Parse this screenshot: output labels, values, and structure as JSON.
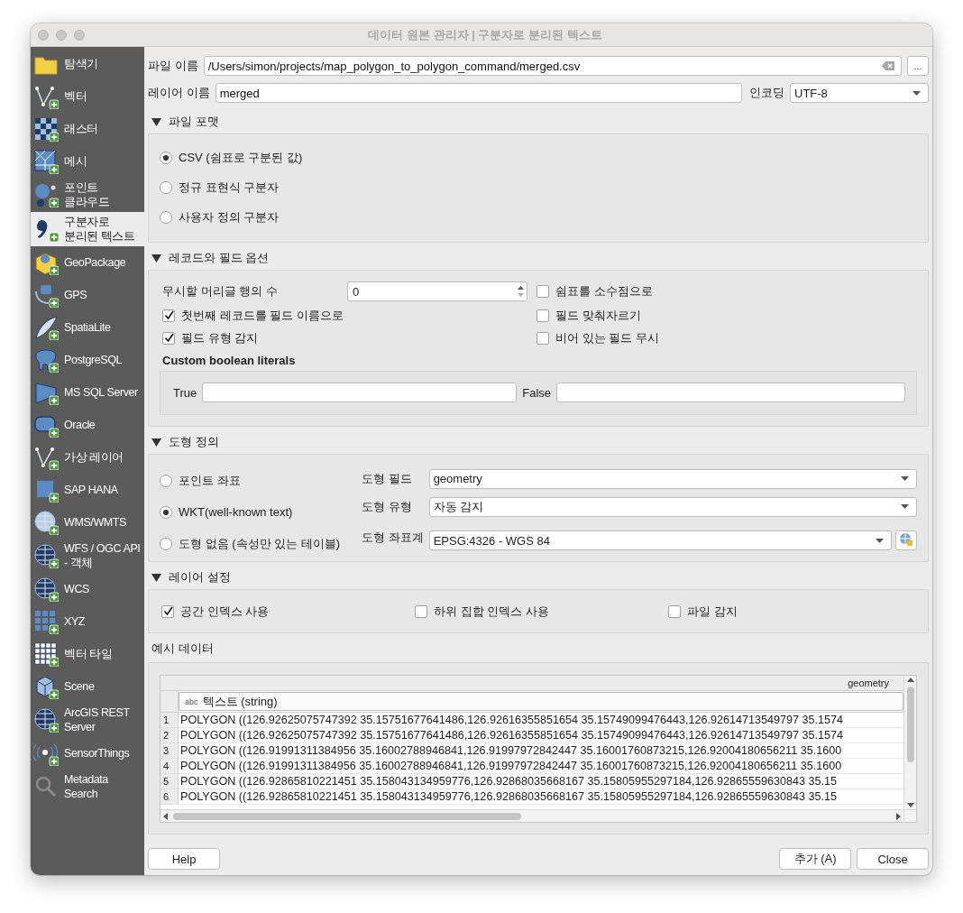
{
  "window": {
    "title": "데이터 원본 관리자 | 구분자로 분리된 텍스트"
  },
  "sidebar": {
    "items": [
      {
        "label": "탐색기",
        "selected": false
      },
      {
        "label": "벡터",
        "selected": false
      },
      {
        "label": "래스터",
        "selected": false
      },
      {
        "label": "메시",
        "selected": false
      },
      {
        "label": "포인트 클라우드",
        "selected": false
      },
      {
        "label": "구분자로 분리된 텍스트",
        "selected": true
      },
      {
        "label": "GeoPackage",
        "selected": false
      },
      {
        "label": "GPS",
        "selected": false
      },
      {
        "label": "SpatiaLite",
        "selected": false
      },
      {
        "label": "PostgreSQL",
        "selected": false
      },
      {
        "label": "MS SQL Server",
        "selected": false
      },
      {
        "label": "Oracle",
        "selected": false
      },
      {
        "label": "가상 레이어",
        "selected": false
      },
      {
        "label": "SAP HANA",
        "selected": false
      },
      {
        "label": "WMS/WMTS",
        "selected": false
      },
      {
        "label": "WFS / OGC API - 객체",
        "selected": false
      },
      {
        "label": "WCS",
        "selected": false
      },
      {
        "label": "XYZ",
        "selected": false
      },
      {
        "label": "벡터 타일",
        "selected": false
      },
      {
        "label": "Scene",
        "selected": false
      },
      {
        "label": "ArcGIS REST Server",
        "selected": false
      },
      {
        "label": "SensorThings",
        "selected": false
      },
      {
        "label": "Metadata Search",
        "selected": false
      }
    ]
  },
  "file_name": {
    "label": "파일 이름",
    "value": "/Users/simon/projects/map_polygon_to_polygon_command/merged.csv",
    "browse": "..."
  },
  "layer_name": {
    "label": "레이어 이름",
    "value": "merged"
  },
  "encoding": {
    "label": "인코딩",
    "value": "UTF-8"
  },
  "file_format": {
    "title": "파일 포맷",
    "expanded": true,
    "options": [
      {
        "label": "CSV (쉼표로 구분된 값)",
        "selected": true
      },
      {
        "label": "정규 표현식 구분자",
        "selected": false
      },
      {
        "label": "사용자 정의 구분자",
        "selected": false
      }
    ]
  },
  "record_options": {
    "title": "레코드와 필드 옵션",
    "expanded": true,
    "header_lines": {
      "label": "무시할 머리글 행의 수",
      "value": "0"
    },
    "checks": [
      {
        "label": "쉼표를 소수점으로",
        "checked": false
      },
      {
        "label": "첫번째 레코드를 필드 이름으로",
        "checked": true
      },
      {
        "label": "필드 맞춰자르기",
        "checked": false
      },
      {
        "label": "필드 유형 감지",
        "checked": true
      },
      {
        "label": "비어 있는 필드 무시",
        "checked": false
      }
    ],
    "boolean_literals": {
      "title": "Custom boolean literals",
      "true_label": "True",
      "false_label": "False"
    }
  },
  "geometry": {
    "title": "도형 정의",
    "expanded": true,
    "options": [
      {
        "label": "포인트 좌표",
        "selected": false
      },
      {
        "label": "WKT(well-known text)",
        "selected": true
      },
      {
        "label": "도형 없음 (속성만 있는 테이블)",
        "selected": false
      }
    ],
    "fields": [
      {
        "label": "도형 필드",
        "value": "geometry",
        "kind": "select"
      },
      {
        "label": "도형 유형",
        "value": "자동 감지",
        "kind": "select"
      },
      {
        "label": "도형 좌표계",
        "value": "EPSG:4326 - WGS 84",
        "kind": "crs"
      }
    ]
  },
  "layer_settings": {
    "title": "레이어 설정",
    "expanded": true,
    "checks": [
      {
        "label": "공간 인덱스 사용",
        "checked": true
      },
      {
        "label": "하위 집합 인덱스 사용",
        "checked": false
      },
      {
        "label": "파일 감지",
        "checked": false
      }
    ]
  },
  "sample_data": {
    "title": "예시 데이터",
    "column": "geometry",
    "type_badge": "abc",
    "type_label": "텍스트 (string)",
    "rows": [
      {
        "num": "1",
        "value": "POLYGON ((126.92625075747392 35.15751677641486,126.92616355851654 35.15749099476443,126.92614713549797 35.1574"
      },
      {
        "num": "2",
        "value": "POLYGON ((126.92625075747392 35.15751677641486,126.92616355851654 35.15749099476443,126.92614713549797 35.1574"
      },
      {
        "num": "3",
        "value": "POLYGON ((126.91991311384956 35.16002788946841,126.91997972842447 35.16001760873215,126.92004180656211 35.1600"
      },
      {
        "num": "4",
        "value": "POLYGON ((126.91991311384956 35.16002788946841,126.91997972842447 35.16001760873215,126.92004180656211 35.1600"
      },
      {
        "num": "5",
        "value": "POLYGON ((126.92865810221451 35.158043134959776,126.92868035668167 35.15805955297184,126.92865559630843 35.15"
      },
      {
        "num": "6",
        "value": "POLYGON ((126.92865810221451 35.158043134959776,126.92868035668167 35.15805955297184,126.92865559630843 35.15"
      }
    ]
  },
  "buttons": {
    "help": "Help",
    "add": "추가 (A)",
    "close": "Close"
  }
}
